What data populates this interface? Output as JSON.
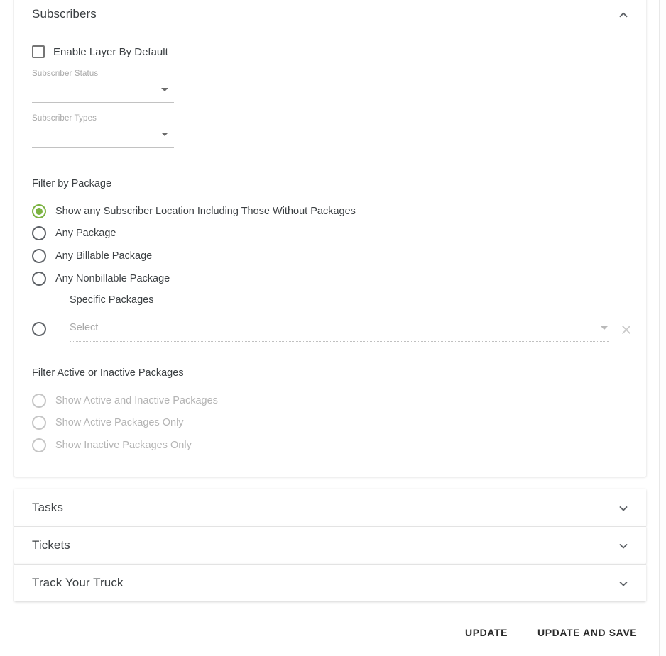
{
  "panel": {
    "title": "Subscribers",
    "collapse_icon": "chevron-up-icon",
    "enable_layer": {
      "label": "Enable Layer By Default",
      "checked": false
    },
    "fields": [
      {
        "label": "Subscriber Status",
        "value": "",
        "arrow_icon": "dropdown-arrow-icon"
      },
      {
        "label": "Subscriber Types",
        "value": "",
        "arrow_icon": "dropdown-arrow-icon"
      }
    ],
    "filter_by_package": {
      "label": "Filter by Package",
      "selected_index": 0,
      "options": [
        "Show any Subscriber Location Including Those Without Packages",
        "Any Package",
        "Any Billable Package",
        "Any Nonbillable Package"
      ],
      "specific_packages_label": "Specific Packages",
      "specific_packages_select": {
        "placeholder": "Select",
        "value": "",
        "disabled": true,
        "arrow_icon": "dropdown-arrow-icon",
        "clear_icon": "close-icon"
      }
    },
    "filter_active_inactive": {
      "label": "Filter Active or Inactive Packages",
      "disabled": true,
      "selected_index": -1,
      "options": [
        "Show Active and Inactive Packages",
        "Show Active Packages Only",
        "Show Inactive Packages Only"
      ]
    }
  },
  "collapsed_panels": [
    {
      "title": "Tasks",
      "expand_icon": "chevron-down-icon"
    },
    {
      "title": "Tickets",
      "expand_icon": "chevron-down-icon"
    },
    {
      "title": "Track Your Truck",
      "expand_icon": "chevron-down-icon"
    }
  ],
  "actions": {
    "update_label": "UPDATE",
    "update_and_save_label": "UPDATE AND SAVE"
  },
  "colors": {
    "accent_green": "#7cb342",
    "text_primary": "#3c4043",
    "text_disabled": "#b4b4b4",
    "card_background": "#ffffff"
  }
}
